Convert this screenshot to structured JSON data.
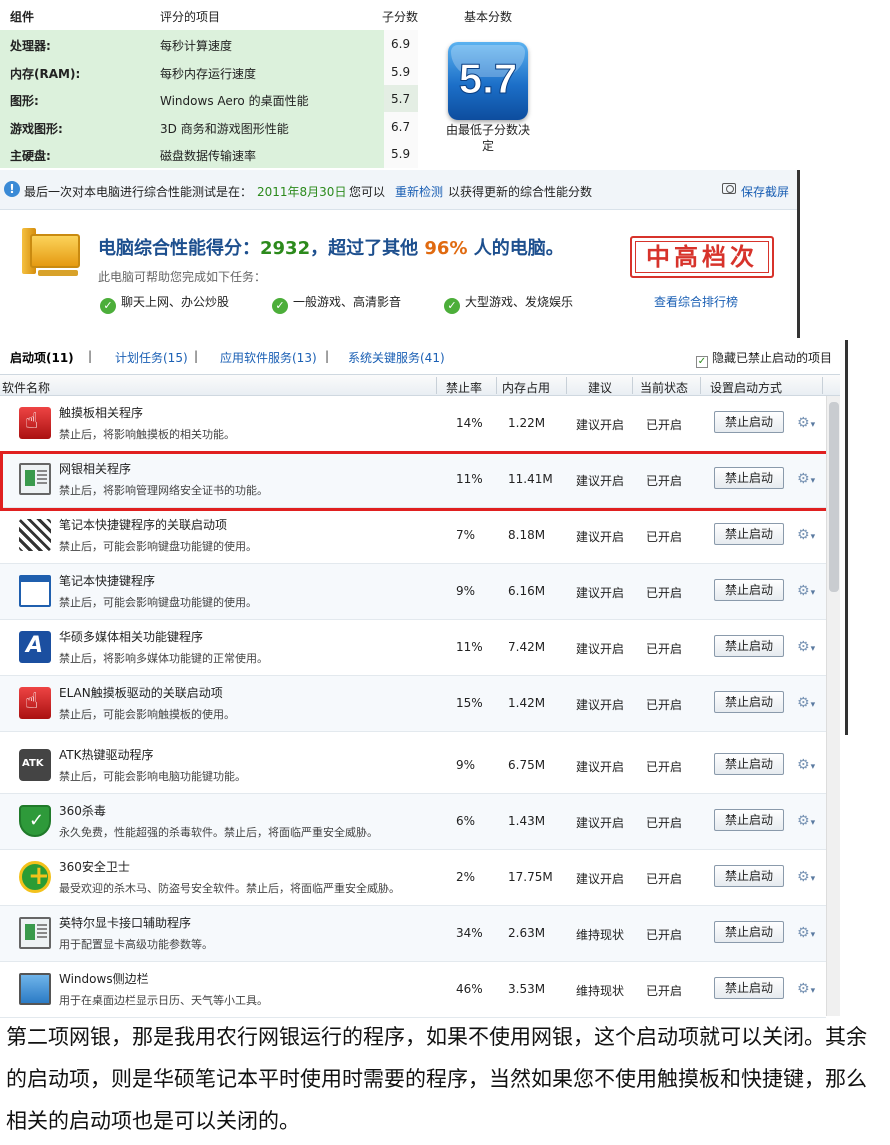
{
  "wei": {
    "headers": {
      "component": "组件",
      "item": "评分的项目",
      "subscore": "子分数",
      "base": "基本分数"
    },
    "rows": [
      {
        "component": "处理器:",
        "item": "每秒计算速度",
        "score": "6.9"
      },
      {
        "component": "内存(RAM):",
        "item": "每秒内存运行速度",
        "score": "5.9"
      },
      {
        "component": "图形:",
        "item": "Windows Aero 的桌面性能",
        "score": "5.7"
      },
      {
        "component": "游戏图形:",
        "item": "3D 商务和游戏图形性能",
        "score": "6.7"
      },
      {
        "component": "主硬盘:",
        "item": "磁盘数据传输速率",
        "score": "5.9"
      }
    ],
    "base_score": "5.7",
    "base_caption": "由最低子分数决定"
  },
  "perf": {
    "notice_prefix": "最后一次对本电脑进行综合性能测试是在：",
    "notice_date": "2011年8月30日",
    "notice_mid": "您可以",
    "retest_link": "重新检测",
    "notice_suffix": "以获得更新的综合性能分数",
    "save_screenshot": "保存截屏",
    "score_label": "电脑综合性能得分：",
    "score_value": "2932",
    "score_mid": "，超过了其他",
    "percent": "96%",
    "score_suffix": "人的电脑。",
    "help_text": "此电脑可帮助您完成如下任务：",
    "features": [
      "聊天上网、办公炒股",
      "一般游戏、高清影音",
      "大型游戏、发烧娱乐"
    ],
    "level_stamp": "中高档次",
    "ranking_link": "查看综合排行榜"
  },
  "startup": {
    "tabs": [
      {
        "label": "启动项(11)",
        "active": true
      },
      {
        "label": "计划任务(15)",
        "active": false
      },
      {
        "label": "应用软件服务(13)",
        "active": false
      },
      {
        "label": "系统关键服务(41)",
        "active": false
      }
    ],
    "tab_separator": "|",
    "hide_disabled_label": "隐藏已禁止启动的项目",
    "hide_disabled_checked": true,
    "columns": [
      "软件名称",
      "禁止率",
      "内存占用",
      "建议",
      "当前状态",
      "设置启动方式"
    ],
    "items": [
      {
        "name": "触摸板相关程序",
        "desc": "禁止后，将影响触摸板的相关功能。",
        "rate": "14%",
        "mem": "1.22M",
        "suggest": "建议开启",
        "status": "已开启",
        "button": "禁止启动",
        "icon": "touchpad-icon"
      },
      {
        "name": "网银相关程序",
        "desc": "禁止后，将影响管理网络安全证书的功能。",
        "rate": "11%",
        "mem": "11.41M",
        "suggest": "建议开启",
        "status": "已开启",
        "button": "禁止启动",
        "icon": "window-app-icon"
      },
      {
        "name": "笔记本快捷键程序的关联启动项",
        "desc": "禁止后，可能会影响键盘功能键的使用。",
        "rate": "7%",
        "mem": "8.18M",
        "suggest": "建议开启",
        "status": "已开启",
        "button": "禁止启动",
        "icon": "keyboard-icon"
      },
      {
        "name": "笔记本快捷键程序",
        "desc": "禁止后，可能会影响键盘功能键的使用。",
        "rate": "9%",
        "mem": "6.16M",
        "suggest": "建议开启",
        "status": "已开启",
        "button": "禁止启动",
        "icon": "blue-window-icon"
      },
      {
        "name": "华硕多媒体相关功能键程序",
        "desc": "禁止后，将影响多媒体功能键的正常使用。",
        "rate": "11%",
        "mem": "7.42M",
        "suggest": "建议开启",
        "status": "已开启",
        "button": "禁止启动",
        "icon": "asus-icon"
      },
      {
        "name": "ELAN触摸板驱动的关联启动项",
        "desc": "禁止后，可能会影响触摸板的使用。",
        "rate": "15%",
        "mem": "1.42M",
        "suggest": "建议开启",
        "status": "已开启",
        "button": "禁止启动",
        "icon": "touchpad-icon"
      },
      {
        "name": "ATK热键驱动程序",
        "desc": "禁止后，可能会影响电脑功能键功能。",
        "rate": "9%",
        "mem": "6.75M",
        "suggest": "建议开启",
        "status": "已开启",
        "button": "禁止启动",
        "icon": "atk-osd-icon"
      },
      {
        "name": "360杀毒",
        "desc": "永久免费，性能超强的杀毒软件。禁止后，将面临严重安全威胁。",
        "rate": "6%",
        "mem": "1.43M",
        "suggest": "建议开启",
        "status": "已开启",
        "button": "禁止启动",
        "icon": "shield-icon"
      },
      {
        "name": "360安全卫士",
        "desc": "最受欢迎的杀木马、防盗号安全软件。禁止后，将面临严重安全威胁。",
        "rate": "2%",
        "mem": "17.75M",
        "suggest": "建议开启",
        "status": "已开启",
        "button": "禁止启动",
        "icon": "360-guard-icon"
      },
      {
        "name": "英特尔显卡接口辅助程序",
        "desc": "用于配置显卡高级功能参数等。",
        "rate": "34%",
        "mem": "2.63M",
        "suggest": "维持现状",
        "status": "已开启",
        "button": "禁止启动",
        "icon": "window-app-icon"
      },
      {
        "name": "Windows侧边栏",
        "desc": "用于在桌面边栏显示日历、天气等小工具。",
        "rate": "46%",
        "mem": "3.53M",
        "suggest": "维持现状",
        "status": "已开启",
        "button": "禁止启动",
        "icon": "monitor-icon"
      }
    ],
    "gear_icon": "gear-icon"
  },
  "article": {
    "text": "第二项网银，那是我用农行网银运行的程序，如果不使用网银，这个启动项就可以关闭。其余的启动项，则是华硕笔记本平时使用时需要的程序，当然如果您不使用触摸板和快捷键，那么相关的启动项也是可以关闭的。"
  }
}
